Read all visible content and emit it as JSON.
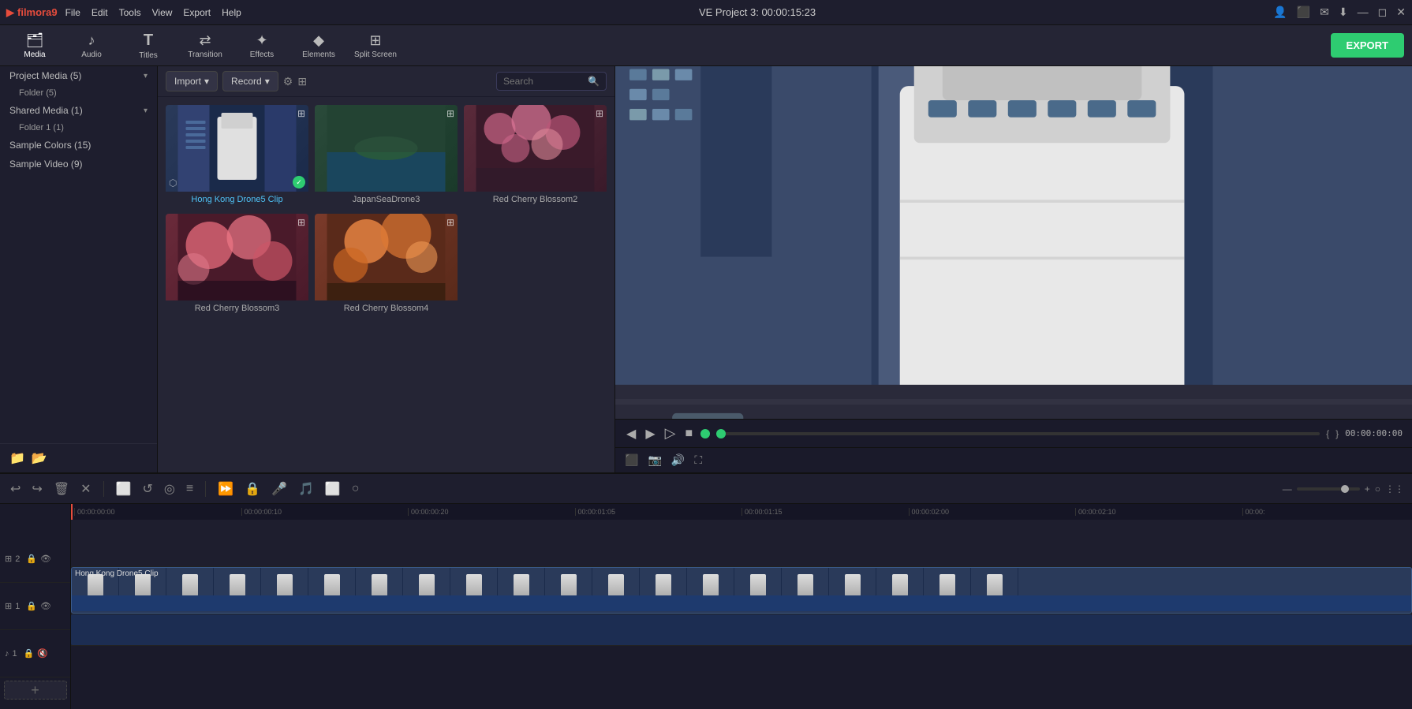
{
  "titlebar": {
    "logo": "filmora9",
    "logo_icon": "▶",
    "menu": [
      "File",
      "Edit",
      "Tools",
      "View",
      "Export",
      "Help"
    ],
    "title": "VE Project 3: 00:00:15:23",
    "controls": [
      "👤",
      "⬜",
      "✉",
      "⬇",
      "—",
      "⬜",
      "✕"
    ]
  },
  "toolbar": {
    "items": [
      {
        "id": "media",
        "icon": "🗂",
        "label": "Media"
      },
      {
        "id": "audio",
        "icon": "🎵",
        "label": "Audio"
      },
      {
        "id": "titles",
        "icon": "T",
        "label": "Titles"
      },
      {
        "id": "transition",
        "icon": "⇄",
        "label": "Transition"
      },
      {
        "id": "effects",
        "icon": "✨",
        "label": "Effects"
      },
      {
        "id": "elements",
        "icon": "🔷",
        "label": "Elements"
      },
      {
        "id": "splitscreen",
        "icon": "⊞",
        "label": "Split Screen"
      }
    ],
    "export_label": "EXPORT"
  },
  "left_panel": {
    "items": [
      {
        "label": "Project Media (5)",
        "expanded": true
      },
      {
        "label": "Folder (5)",
        "sub": true
      },
      {
        "label": "Shared Media (1)",
        "expanded": true
      },
      {
        "label": "Folder 1 (1)",
        "sub": true
      },
      {
        "label": "Sample Colors (15)",
        "expanded": false
      },
      {
        "label": "Sample Video (9)",
        "expanded": false
      }
    ],
    "footer_icons": [
      "📁+",
      "📁"
    ]
  },
  "media_panel": {
    "import_label": "Import",
    "record_label": "Record",
    "search_placeholder": "Search",
    "items": [
      {
        "id": 1,
        "label": "Hong Kong Drone5 Clip",
        "selected": true,
        "thumb_class": "thumb-hk"
      },
      {
        "id": 2,
        "label": "JapanSeaDrone3",
        "selected": false,
        "thumb_class": "thumb-japan"
      },
      {
        "id": 3,
        "label": "Red Cherry Blossom2",
        "selected": false,
        "thumb_class": "thumb-cherry"
      },
      {
        "id": 4,
        "label": "Red Cherry Blossom3",
        "selected": false,
        "thumb_class": "thumb-cherry3"
      },
      {
        "id": 5,
        "label": "Red Cherry Blossom4",
        "selected": false,
        "thumb_class": "thumb-cherry4"
      }
    ]
  },
  "preview": {
    "timecode": "00:00:00:00",
    "total_time": "00:00:15:23"
  },
  "timeline": {
    "toolbar_icons": [
      "↩",
      "↪",
      "🗑",
      "✕",
      "⬜",
      "↺",
      "⏺",
      "≡"
    ],
    "zoom_icons": [
      "🔍-",
      "🔍+"
    ],
    "ruler_marks": [
      "00:00:00:00",
      "00:00:00:10",
      "00:00:00:20",
      "00:00:01:05",
      "00:00:01:15",
      "00:00:02:00",
      "00:00:02:10",
      "00:00:"
    ],
    "tracks": [
      {
        "id": "v2",
        "label": "2",
        "icon": "⊞",
        "lock": true,
        "eye": true
      },
      {
        "id": "v1",
        "label": "1",
        "icon": "⊞",
        "lock": true,
        "eye": true,
        "has_clip": true,
        "clip_label": "Hong Kong Drone5 Clip"
      },
      {
        "id": "a1",
        "label": "1",
        "icon": "🎵",
        "lock": true,
        "mute": true
      }
    ]
  }
}
